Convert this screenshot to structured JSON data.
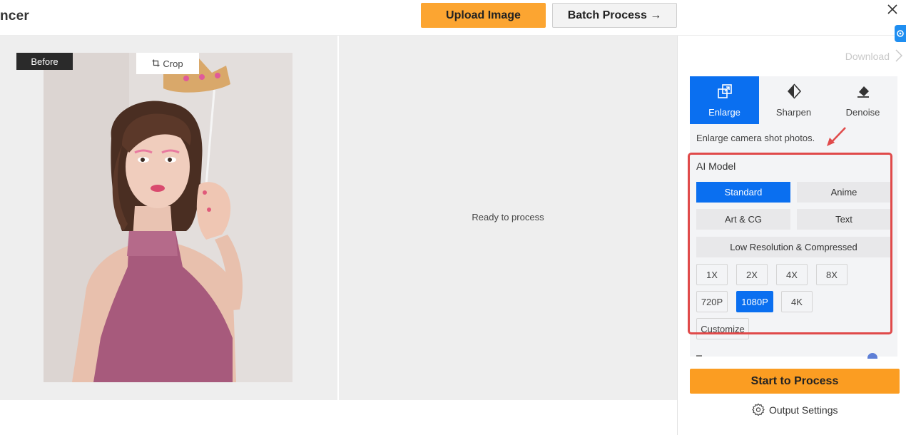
{
  "header": {
    "app_title": "ncer",
    "upload_label": "Upload Image",
    "batch_label": "Batch Process →"
  },
  "preview": {
    "before_label": "Before",
    "crop_label": "Crop",
    "ready_text": "Ready to process"
  },
  "panel": {
    "download_label": "Download",
    "tabs": [
      {
        "label": "Enlarge",
        "icon": "enlarge-icon",
        "active": true
      },
      {
        "label": "Sharpen",
        "icon": "sharpen-icon",
        "active": false
      },
      {
        "label": "Denoise",
        "icon": "denoise-icon",
        "active": false
      }
    ],
    "description": "Enlarge camera shot photos.",
    "ai_model_label": "AI Model",
    "models": [
      {
        "label": "Standard",
        "active": true
      },
      {
        "label": "Anime",
        "active": false
      },
      {
        "label": "Art & CG",
        "active": false
      },
      {
        "label": "Text",
        "active": false
      },
      {
        "label": "Low Resolution & Compressed",
        "active": false
      }
    ],
    "scales": [
      {
        "label": "1X",
        "active": false
      },
      {
        "label": "2X",
        "active": false
      },
      {
        "label": "4X",
        "active": false
      },
      {
        "label": "8X",
        "active": false
      }
    ],
    "resolutions": [
      {
        "label": "720P",
        "active": false
      },
      {
        "label": "1080P",
        "active": true
      },
      {
        "label": "4K",
        "active": false
      }
    ],
    "customize_label": "Customize",
    "start_label": "Start to Process",
    "output_settings_label": "Output Settings"
  },
  "colors": {
    "accent_blue": "#0a6ff0",
    "accent_orange": "#fca531",
    "highlight_red": "#e04a4a"
  }
}
